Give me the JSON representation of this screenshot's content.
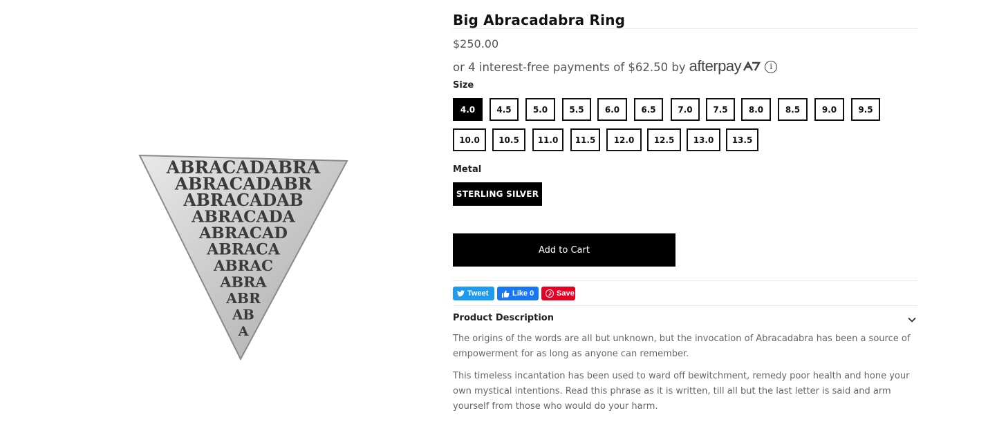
{
  "product": {
    "title": "Big Abracadabra Ring",
    "price": "$250.00",
    "image_alt": "Big Abracadabra Ring"
  },
  "afterpay": {
    "text": "or 4 interest-free payments of $62.50 by",
    "logo_text": "afterpay",
    "info_glyph": "i"
  },
  "size": {
    "label": "Size",
    "options": [
      "4.0",
      "4.5",
      "5.0",
      "5.5",
      "6.0",
      "6.5",
      "7.0",
      "7.5",
      "8.0",
      "8.5",
      "9.0",
      "9.5",
      "10.0",
      "10.5",
      "11.0",
      "11.5",
      "12.0",
      "12.5",
      "13.0",
      "13.5"
    ],
    "selected": "4.0"
  },
  "metal": {
    "label": "Metal",
    "options": [
      "STERLING SILVER"
    ],
    "selected": "STERLING SILVER"
  },
  "cart": {
    "label": "Add to Cart"
  },
  "social": {
    "tweet": "Tweet",
    "like": "Like 0",
    "save": "Save"
  },
  "description": {
    "heading": "Product Description",
    "paragraphs": [
      "The origins of the words are all but unknown, but the invocation of Abracadabra has been a source of empowerment for as long as anyone can remember.",
      "This timeless incantation has been used to ward off bewitchment, remedy poor health and hone your own mystical intentions. Read this phrase as it is written, till all but the last letter is said and arm yourself from those who would do your harm."
    ]
  },
  "ring_inscription": [
    "ABRACADABRA",
    "ABRACADABR",
    "ABRACADAB",
    "ABRACADA",
    "ABRACAD",
    "ABRACA",
    "ABRAC",
    "ABRA",
    "ABR",
    "AB",
    "A"
  ],
  "colors": {
    "accent": "#000000",
    "twitter": "#1d9bf0",
    "facebook": "#1877f2",
    "pinterest": "#e60023"
  }
}
